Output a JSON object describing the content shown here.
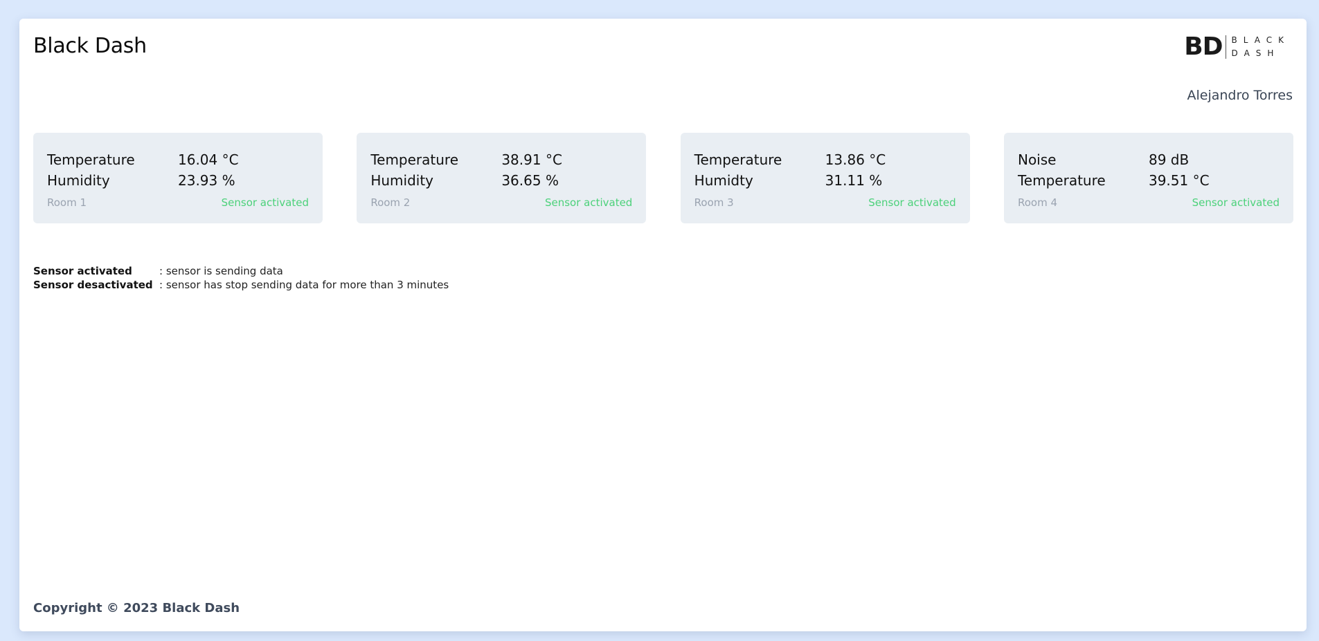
{
  "header": {
    "title": "Black Dash",
    "logo": {
      "mark": "BD",
      "line1": "BLACK",
      "line2": "DASH"
    },
    "user": "Alejandro Torres"
  },
  "cards": [
    {
      "metrics": [
        {
          "label": "Temperature",
          "value": "16.04 °C"
        },
        {
          "label": "Humidity",
          "value": "23.93 %"
        }
      ],
      "room": "Room 1",
      "status": "Sensor activated"
    },
    {
      "metrics": [
        {
          "label": "Temperature",
          "value": "38.91 °C"
        },
        {
          "label": "Humidity",
          "value": "36.65 %"
        }
      ],
      "room": "Room 2",
      "status": "Sensor activated"
    },
    {
      "metrics": [
        {
          "label": "Temperature",
          "value": "13.86 °C"
        },
        {
          "label": "Humidty",
          "value": "31.11 %"
        }
      ],
      "room": "Room 3",
      "status": "Sensor activated"
    },
    {
      "metrics": [
        {
          "label": "Noise",
          "value": "89 dB"
        },
        {
          "label": "Temperature",
          "value": "39.51 °C"
        }
      ],
      "room": "Room 4",
      "status": "Sensor activated"
    }
  ],
  "legend": [
    {
      "term": "Sensor activated",
      "description": ": sensor is sending data"
    },
    {
      "term": "Sensor desactivated",
      "description": ": sensor has stop sending data for more than 3 minutes"
    }
  ],
  "footer": {
    "copyright": "Copyright © 2023 Black Dash"
  },
  "colors": {
    "background": "#dae8fc",
    "card": "#e9eef3",
    "status_active": "#4cd17a",
    "room_label": "#9aa3b0"
  }
}
